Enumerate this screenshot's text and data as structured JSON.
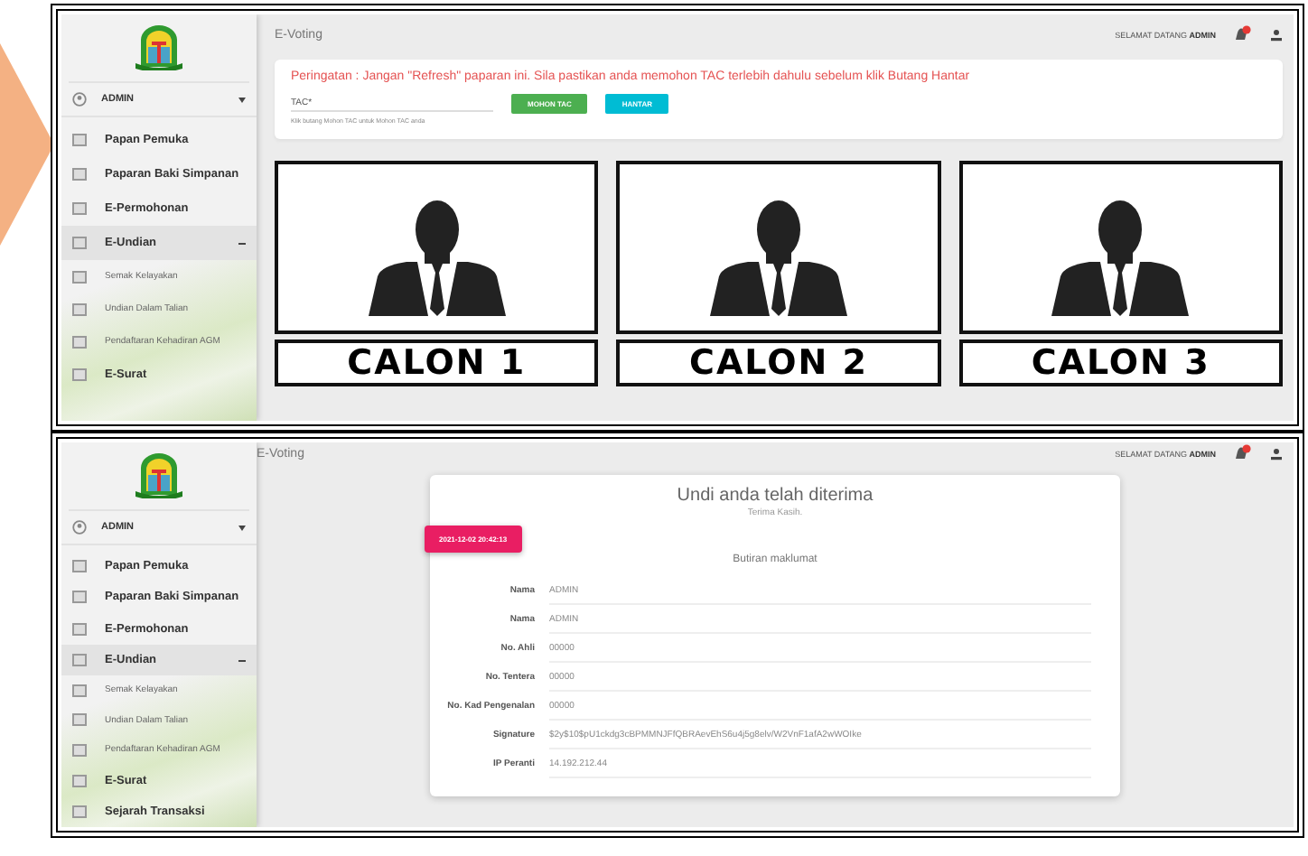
{
  "screens": [
    {
      "kind": "voting",
      "header": {
        "title": "E-Voting",
        "welcome": "SELAMAT DATANG",
        "user": "ADMIN"
      },
      "sidebar": {
        "user": "ADMIN",
        "items": [
          {
            "label": "Papan Pemuka",
            "selected": false
          },
          {
            "label": "Paparan Baki Simpanan",
            "selected": false
          },
          {
            "label": "E-Permohonan",
            "selected": false
          },
          {
            "label": "E-Undian",
            "selected": true,
            "expanded": true,
            "children": [
              {
                "label": "Semak Kelayakan"
              },
              {
                "label": "Undian Dalam Talian"
              },
              {
                "label": "Pendaftaran Kehadiran AGM"
              }
            ]
          },
          {
            "label": "E-Surat",
            "selected": false
          }
        ]
      },
      "warning": "Peringatan : Jangan \"Refresh\" paparan ini. Sila pastikan anda memohon TAC terlebih dahulu sebelum klik Butang Hantar",
      "tac": {
        "label": "TAC*",
        "hint": "Klik butang Mohon TAC untuk Mohon TAC anda"
      },
      "buttons": [
        {
          "label": "MOHON TAC",
          "kind": "request"
        },
        {
          "label": "HANTAR",
          "kind": "submit"
        }
      ],
      "candidates": [
        "CALON 1",
        "CALON 2",
        "CALON 3"
      ]
    },
    {
      "kind": "receipt",
      "header": {
        "title": "E-Voting",
        "welcome": "SELAMAT DATANG",
        "user": "ADMIN"
      },
      "sidebar": {
        "user": "ADMIN",
        "items": [
          {
            "label": "Papan Pemuka",
            "selected": false
          },
          {
            "label": "Paparan Baki Simpanan",
            "selected": false
          },
          {
            "label": "E-Permohonan",
            "selected": false
          },
          {
            "label": "E-Undian",
            "selected": true,
            "expanded": true,
            "children": [
              {
                "label": "Semak Kelayakan"
              },
              {
                "label": "Undian Dalam Talian"
              },
              {
                "label": "Pendaftaran Kehadiran AGM"
              }
            ]
          },
          {
            "label": "E-Surat",
            "selected": false
          },
          {
            "label": "Sejarah Transaksi",
            "selected": false
          }
        ]
      },
      "card": {
        "title": "Undi anda telah diterima",
        "subtitle": "Terima Kasih.",
        "timestamp": "2021-12-02 20:42:13",
        "section": "Butiran maklumat",
        "rows": [
          {
            "label": "Nama",
            "value": "ADMIN"
          },
          {
            "label": "Nama",
            "value": "ADMIN"
          },
          {
            "label": "No. Ahli",
            "value": "00000"
          },
          {
            "label": "No. Tentera",
            "value": "00000"
          },
          {
            "label": "No. Kad Pengenalan",
            "value": "00000"
          },
          {
            "label": "Signature",
            "value": "$2y$10$pU1ckdg3cBPMMNJFfQBRAevEhS6u4j5g8elv/W2VnF1afA2wWOIke"
          },
          {
            "label": "IP Peranti",
            "value": "14.192.212.44"
          }
        ]
      }
    }
  ]
}
